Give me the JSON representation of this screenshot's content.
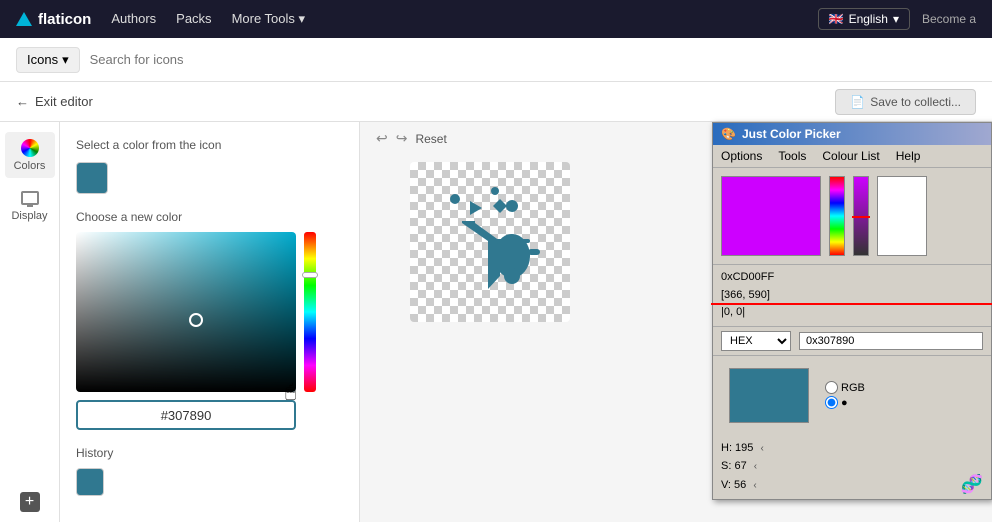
{
  "topNav": {
    "logo_text": "flaticon",
    "nav_items": [
      "Authors",
      "Packs",
      "More Tools"
    ],
    "more_tools_label": "More Tools",
    "lang_btn": "English",
    "become_label": "Become a"
  },
  "searchBar": {
    "icons_dropdown": "Icons",
    "search_placeholder": "Search for icons"
  },
  "editorBar": {
    "exit_label": "Exit editor",
    "save_label": "Save to collecti..."
  },
  "sidebar": {
    "colors_label": "Colors",
    "display_label": "Display",
    "add_label": "+"
  },
  "colorPanel": {
    "select_title": "Select a color from the icon",
    "choose_title": "Choose a new color",
    "hex_value": "#307890",
    "history_title": "History"
  },
  "jcp": {
    "title": "Just Color Picker",
    "menu": [
      "Options",
      "Tools",
      "Colour List",
      "Help"
    ],
    "color_display": "#CD00FF",
    "hex_label": "0xCD00FF",
    "coords_label": "[366, 590]",
    "origin_label": "|0, 0|",
    "format_select": "HEX",
    "format_value": "0x307890",
    "swatch_color": "#307890",
    "hsv": {
      "h_label": "H: 195",
      "s_label": "S: 67",
      "v_label": "V: 56"
    },
    "rgb_label": "RGB"
  },
  "iconPreview": {
    "reset_label": "Reset"
  }
}
